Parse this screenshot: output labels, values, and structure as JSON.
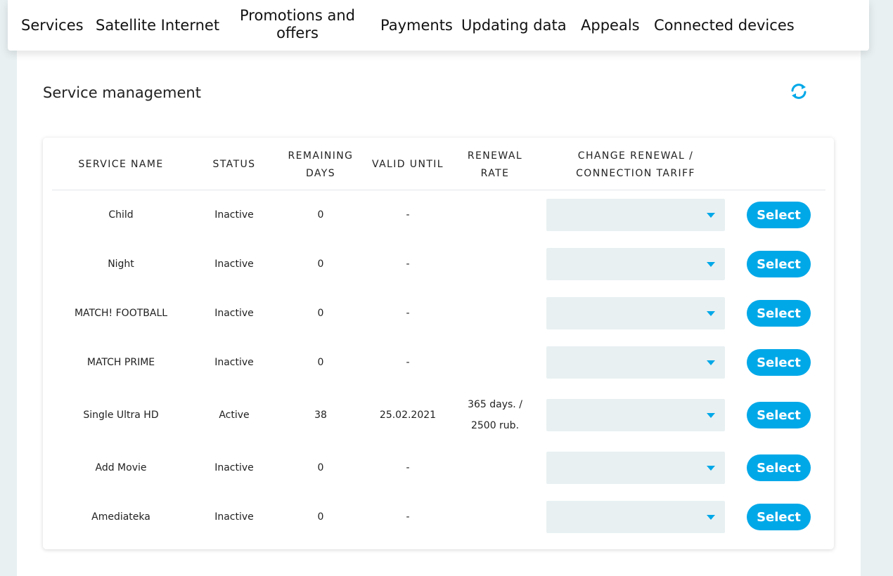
{
  "nav": {
    "items": [
      "Services",
      "Satellite Internet",
      "Promotions and offers",
      "Payments",
      "Updating data",
      "Appeals",
      "Connected devices"
    ]
  },
  "section": {
    "title": "Service management"
  },
  "icons": {
    "refresh": "refresh-icon",
    "dropdown": "chevron-down-icon"
  },
  "colors": {
    "accent": "#00a8e8",
    "background": "#e8f0f2",
    "dropdown_bg": "#e8f0f2"
  },
  "table": {
    "headers": {
      "service_name": "SERVICE NAME",
      "status": "STATUS",
      "remaining_days_1": "REMAINING",
      "remaining_days_2": "DAYS",
      "valid_until": "VALID UNTIL",
      "renewal_rate_1": "RENEWAL",
      "renewal_rate_2": "RATE",
      "change_1": "CHANGE RENEWAL /",
      "change_2": "CONNECTION TARIFF"
    },
    "rows": [
      {
        "name": "Child",
        "status": "Inactive",
        "days": "0",
        "valid": "-",
        "rate_1": "",
        "rate_2": "",
        "dropdown": "",
        "button": "Select"
      },
      {
        "name": "Night",
        "status": "Inactive",
        "days": "0",
        "valid": "-",
        "rate_1": "",
        "rate_2": "",
        "dropdown": "",
        "button": "Select"
      },
      {
        "name": "MATCH! FOOTBALL",
        "status": "Inactive",
        "days": "0",
        "valid": "-",
        "rate_1": "",
        "rate_2": "",
        "dropdown": "",
        "button": "Select"
      },
      {
        "name": "MATCH PRIME",
        "status": "Inactive",
        "days": "0",
        "valid": "-",
        "rate_1": "",
        "rate_2": "",
        "dropdown": "",
        "button": "Select"
      },
      {
        "name": "Single Ultra HD",
        "status": "Active",
        "days": "38",
        "valid": "25.02.2021",
        "rate_1": "365 days. /",
        "rate_2": "2500 rub.",
        "dropdown": "",
        "button": "Select"
      },
      {
        "name": "Add Movie",
        "status": "Inactive",
        "days": "0",
        "valid": "-",
        "rate_1": "",
        "rate_2": "",
        "dropdown": "",
        "button": "Select"
      },
      {
        "name": "Amediateka",
        "status": "Inactive",
        "days": "0",
        "valid": "-",
        "rate_1": "",
        "rate_2": "",
        "dropdown": "",
        "button": "Select"
      }
    ]
  }
}
